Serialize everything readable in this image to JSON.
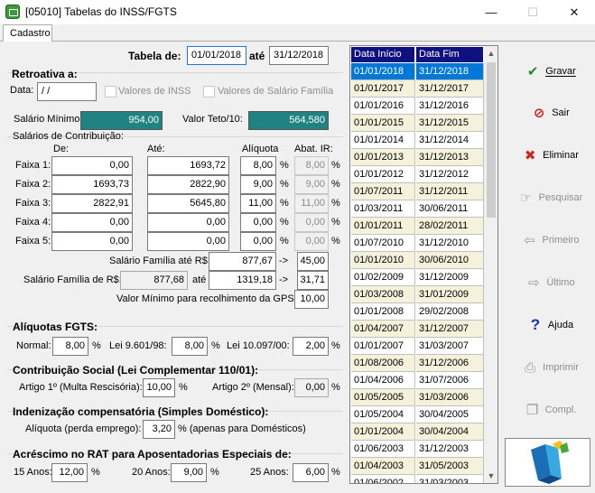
{
  "window": {
    "title": "[05010] Tabelas do INSS/FGTS",
    "minimize": "—",
    "maximize": "☐",
    "close": "✕"
  },
  "tabs": [
    {
      "label": "Cadastro"
    }
  ],
  "tabela": {
    "label": "Tabela de:",
    "de": "01/01/2018",
    "ate_label": "até",
    "ate": "31/12/2018"
  },
  "retroativa": {
    "title": "Retroativa a:",
    "data_label": "Data:",
    "data_value": " /  /",
    "inss_label": "Valores de INSS",
    "sal_familia_label": "Valores de Salário Família"
  },
  "salario_minimo": {
    "label": "Salário Mínimo:",
    "value": "954,00"
  },
  "valor_teto": {
    "label": "Valor Teto/10:",
    "value": "564,580"
  },
  "contribuicao": {
    "title": "Salários de Contribuição:",
    "col_de": "De:",
    "col_ate": "Até:",
    "col_aliquota": "Alíquota",
    "col_abat": "Abat. IR:",
    "pct": "%",
    "faixas": [
      {
        "label": "Faixa 1:",
        "de": "0,00",
        "ate": "1693,72",
        "aliquota": "8,00",
        "abat": "8,00"
      },
      {
        "label": "Faixa 2:",
        "de": "1693,73",
        "ate": "2822,90",
        "aliquota": "9,00",
        "abat": "9,00"
      },
      {
        "label": "Faixa 3:",
        "de": "2822,91",
        "ate": "5645,80",
        "aliquota": "11,00",
        "abat": "11,00"
      },
      {
        "label": "Faixa 4:",
        "de": "0,00",
        "ate": "0,00",
        "aliquota": "0,00",
        "abat": "0,00"
      },
      {
        "label": "Faixa 5:",
        "de": "0,00",
        "ate": "0,00",
        "aliquota": "0,00",
        "abat": "0,00"
      }
    ]
  },
  "salario_familia": {
    "ate_label": "Salário Família até R$:",
    "ate_value": "877,67",
    "arrow": "->",
    "ate_cota": "45,00",
    "de_label": "Salário Família de R$:",
    "de_value": "877,68",
    "de_ate_label": "até",
    "de_ate_value": "1319,18",
    "de_cota": "31,71"
  },
  "gps": {
    "label": "Valor Mínimo para recolhimento da GPS:",
    "value": "10,00"
  },
  "fgts": {
    "title": "Alíquotas FGTS:",
    "normal_label": "Normal:",
    "normal_value": "8,00",
    "lei9601_label": "Lei 9.601/98:",
    "lei9601_value": "8,00",
    "lei10097_label": "Lei 10.097/00:",
    "lei10097_value": "2,00",
    "pct": "%"
  },
  "contribuicao_social": {
    "title": "Contribuição Social (Lei Complementar 110/01):",
    "art1_label": "Artigo 1º (Multa Rescisória):",
    "art1_value": "10,00",
    "art2_label": "Artigo 2º (Mensal):",
    "art2_value": "0,00",
    "pct": "%"
  },
  "indenizacao": {
    "title": "Indenização compensatória (Simples Doméstico):",
    "label": "Alíquota (perda emprego):",
    "value": "3,20",
    "suffix": "% (apenas para Domésticos)"
  },
  "rat": {
    "title": "Acréscimo no RAT para Aposentadorias Especiais de:",
    "a15_label": "15 Anos:",
    "a15_value": "12,00",
    "a20_label": "20 Anos:",
    "a20_value": "9,00",
    "a25_label": "25 Anos:",
    "a25_value": "6,00",
    "pct": "%"
  },
  "grid": {
    "headers": [
      "Data Início",
      "Data Fim"
    ],
    "rows": [
      [
        "01/01/2018",
        "31/12/2018"
      ],
      [
        "01/01/2017",
        "31/12/2017"
      ],
      [
        "01/01/2016",
        "31/12/2016"
      ],
      [
        "01/01/2015",
        "31/12/2015"
      ],
      [
        "01/01/2014",
        "31/12/2014"
      ],
      [
        "01/01/2013",
        "31/12/2013"
      ],
      [
        "01/01/2012",
        "31/12/2012"
      ],
      [
        "01/07/2011",
        "31/12/2011"
      ],
      [
        "01/03/2011",
        "30/06/2011"
      ],
      [
        "01/01/2011",
        "28/02/2011"
      ],
      [
        "01/07/2010",
        "31/12/2010"
      ],
      [
        "01/01/2010",
        "30/06/2010"
      ],
      [
        "01/02/2009",
        "31/12/2009"
      ],
      [
        "01/03/2008",
        "31/01/2009"
      ],
      [
        "01/01/2008",
        "29/02/2008"
      ],
      [
        "01/04/2007",
        "31/12/2007"
      ],
      [
        "01/01/2007",
        "31/03/2007"
      ],
      [
        "01/08/2006",
        "31/12/2006"
      ],
      [
        "01/04/2006",
        "31/07/2006"
      ],
      [
        "01/05/2005",
        "31/03/2006"
      ],
      [
        "01/05/2004",
        "30/04/2005"
      ],
      [
        "01/01/2004",
        "30/04/2004"
      ],
      [
        "01/06/2003",
        "31/12/2003"
      ],
      [
        "01/04/2003",
        "31/05/2003"
      ],
      [
        "01/06/2002",
        "31/03/2003"
      ]
    ],
    "scroll_up": "▲",
    "scroll_down": "▼"
  },
  "buttons": {
    "gravar": {
      "label": "Gravar",
      "icon": "✔"
    },
    "sair": {
      "label": "Sair",
      "icon": "⊘"
    },
    "eliminar": {
      "label": "Eliminar",
      "icon": "✖"
    },
    "pesquisar": {
      "label": "Pesquisar",
      "icon": "☞"
    },
    "primeiro": {
      "label": "Primeiro",
      "icon": "⇦"
    },
    "ultimo": {
      "label": "Último",
      "icon": "⇨"
    },
    "ajuda": {
      "label": "Ajuda",
      "icon": "?"
    },
    "imprimir": {
      "label": "Imprimir",
      "icon": "⎙"
    },
    "compl": {
      "label": "Compl.",
      "icon": "❐"
    }
  },
  "colors": {
    "teal": "#1f8382",
    "grid_header": "#101080",
    "grid_selected": "#0078d7",
    "grid_alt": "#f5f2dc",
    "gravar_icon": "#2a8a2a",
    "sair_icon": "#cc1f1f",
    "eliminar_icon": "#c8281e",
    "ajuda_icon": "#1a2fb0"
  }
}
